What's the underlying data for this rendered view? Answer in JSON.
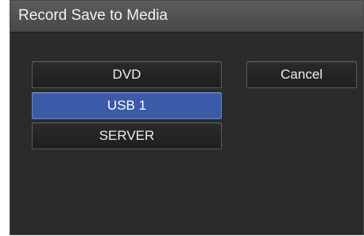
{
  "dialog": {
    "title": "Record Save to Media"
  },
  "media_options": [
    {
      "label": "DVD",
      "selected": false
    },
    {
      "label": "USB 1",
      "selected": true
    },
    {
      "label": "SERVER",
      "selected": false
    }
  ],
  "cancel_label": "Cancel",
  "colors": {
    "background": "#2b2b2b",
    "titlebar": "#505050",
    "selected": "#3b5aa8",
    "text": "#ececec"
  }
}
